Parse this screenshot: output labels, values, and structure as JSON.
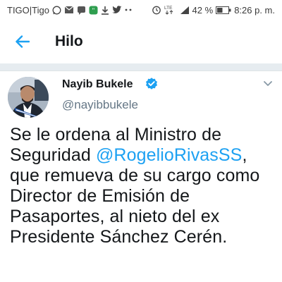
{
  "status_bar": {
    "carrier": "TIGO|Tigo",
    "battery_percent": "42 %",
    "time": "8:26 p. m.",
    "network_label": "LTE",
    "icons_left": [
      "whatsapp-icon",
      "mail-icon",
      "chat-icon",
      "hangouts-icon",
      "download-icon",
      "twitter-icon",
      "more-dots-icon"
    ],
    "icons_right": [
      "alarm-icon",
      "network-icon",
      "signal-icon",
      "battery-icon"
    ]
  },
  "header": {
    "title": "Hilo",
    "back_icon": "arrow-left-icon"
  },
  "tweet": {
    "author_name": "Nayib Bukele",
    "author_handle": "@nayibbukele",
    "text_before": "Se le ordena al Ministro de Seguridad ",
    "mention": "@RogelioRivasSS",
    "text_after": ", que remueva de su cargo como Director de Emisión de Pasaportes, al nieto del ex Presidente Sánchez Cerén."
  },
  "colors": {
    "accent": "#1da1f2",
    "text": "#14171a",
    "secondary_text": "#657786",
    "divider": "#e6ecf0"
  }
}
